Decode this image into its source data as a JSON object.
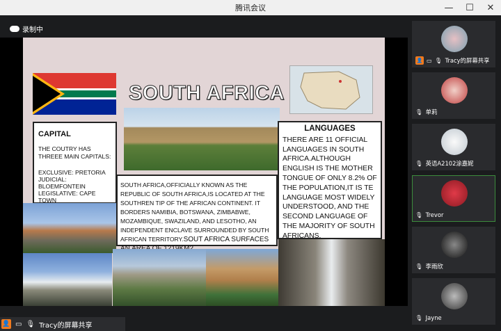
{
  "window": {
    "title": "腾讯会议",
    "min": "—",
    "max": "☐",
    "close": "✕"
  },
  "recording": {
    "label": "录制中"
  },
  "slide": {
    "title": "SOUTH AFRICA",
    "capital": {
      "heading": "CAPITAL",
      "lines": [
        "THE COUTRY HAS THREEE MAIN CAPITALS:",
        "EXCLUSIVE: PRETORIA",
        "JUDICIAL: BLOEMFONTEIN",
        "LEGISLATIVE: CAPE TOWN"
      ]
    },
    "languages": {
      "heading": "LANGUAGES",
      "body": "THERE ARE 11 OFFICIAL LANGUAGES IN SOUTH AFRICA.ALTHOUGH ENGLISH IS THE MOTHER TONGUE OF ONLY 8.2% OF THE POPULATION,IT IS TE LANGUAGE MOST WIDELY UNDERSTOOD, AND THE SECOND LANGUAGE OF THE MAJORITY OF SOUTH AFRICANS."
    },
    "description": {
      "body": "SOUTH AFRICA,OFFICIALLY KNOWN AS THE REPUBLIC OF SOUTH AFRICA,IS LOCATED AT THE SOUTHREN TIP OF THE AFRICAN CONTINENT. IT BORDERS NAMIBIA, BOTSWANA, ZIMBABWE, MOZAMBIQUE, SWAZILAND, AND LESOTHO, AN INDEPENDENT ENCLAVE SURROUNDED BY SOUTH AFRICAN TERRITORY.",
      "tail": "SOUT AFRICA SURFACES AN AREA OF 1219KM2"
    }
  },
  "share_bar": {
    "label": "Tracy的屏幕共享"
  },
  "participants": [
    {
      "name": "Tracy的屏幕共享",
      "sharing": true
    },
    {
      "name": "单莉",
      "sharing": false
    },
    {
      "name": "英语A2102涂嘉妮",
      "sharing": false
    },
    {
      "name": "Trevor",
      "sharing": false
    },
    {
      "name": "李雨欣",
      "sharing": false
    },
    {
      "name": "Jayne",
      "sharing": false
    }
  ],
  "colors": {
    "accent": "#f07a1e",
    "active_border": "#3c8c3c"
  }
}
